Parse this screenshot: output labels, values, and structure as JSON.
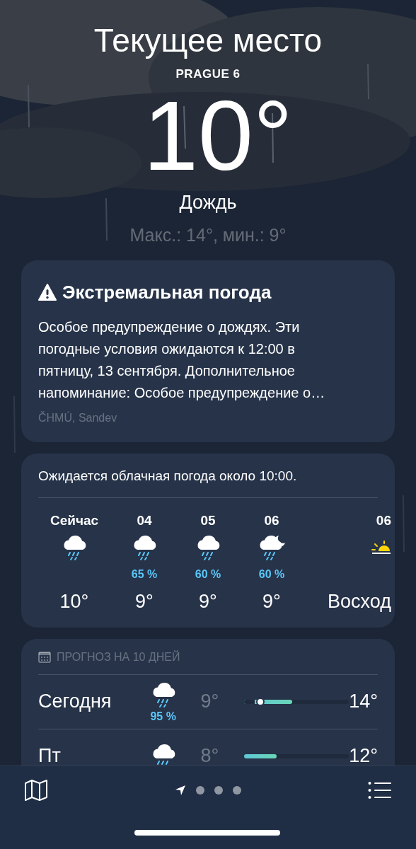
{
  "header": {
    "title": "Текущее место",
    "location": "PRAGUE 6",
    "temperature": "10°",
    "condition": "Дождь",
    "high_low": "Макс.: 14°, мин.: 9°"
  },
  "alert": {
    "title": "Экстремальная погода",
    "text": "Особое предупреждение о дождях. Эти погодные условия ожидаются к 12:00 в пятницу, 13 сентября. Дополнительное напоминание: Особое предупреждение о…",
    "source": "ČHMÚ, Sandev"
  },
  "hourly": {
    "summary": "Ожидается облачная погода около 10:00.",
    "items": [
      {
        "kind": "rain",
        "time": "Сейчас",
        "temp": "10°"
      },
      {
        "kind": "rain",
        "time": "04",
        "chance": "65 %",
        "temp": "9°"
      },
      {
        "kind": "rain",
        "time": "05",
        "chance": "60 %",
        "temp": "9°"
      },
      {
        "kind": "night-rain",
        "time": "06",
        "chance": "60 %",
        "temp": "9°"
      },
      {
        "kind": "sunrise",
        "time": "06",
        "temp": "Восход"
      }
    ]
  },
  "daily": {
    "heading": "ПРОГНОЗ НА 10 ДНЕЙ",
    "days": [
      {
        "day": "Сегодня",
        "chance": "95 %",
        "low": "9°",
        "high": "14°",
        "start": {
          "level": 0.1
        },
        "end": {
          "level": 0.46
        },
        "current": {
          "level": 0.15
        }
      },
      {
        "day": "Пт",
        "low": "8°",
        "high": "12°",
        "end": {
          "level": 0.31
        }
      }
    ]
  },
  "toolbar": {
    "pages": [
      {
        "kind": "location",
        "selected": true
      },
      {
        "kind": "dot",
        "selected": false
      },
      {
        "kind": "dot",
        "selected": false
      },
      {
        "kind": "dot",
        "selected": false
      }
    ]
  }
}
